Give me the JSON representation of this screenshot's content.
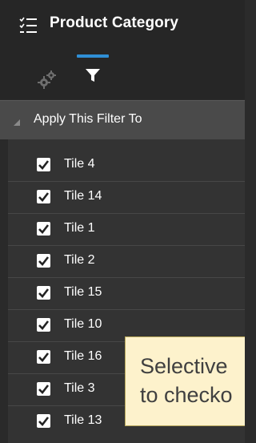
{
  "header": {
    "title": "Product Category",
    "icon": "filter-list-icon"
  },
  "toolbar": {
    "tabs": [
      {
        "name": "settings",
        "icon": "gears-icon",
        "active": false
      },
      {
        "name": "filter",
        "icon": "filter-icon",
        "active": true
      }
    ],
    "accent_color": "#2f8fd6"
  },
  "section": {
    "label": "Apply This Filter To",
    "expanded": true
  },
  "items": [
    {
      "label": "Tile 4",
      "checked": true
    },
    {
      "label": "Tile 14",
      "checked": true
    },
    {
      "label": "Tile 1",
      "checked": true
    },
    {
      "label": "Tile 2",
      "checked": true
    },
    {
      "label": "Tile 15",
      "checked": true
    },
    {
      "label": "Tile 10",
      "checked": true
    },
    {
      "label": "Tile 16",
      "checked": true
    },
    {
      "label": "Tile 3",
      "checked": true
    },
    {
      "label": "Tile 13",
      "checked": true
    }
  ],
  "callout": {
    "line1": "Selective",
    "line2": "to checko"
  }
}
